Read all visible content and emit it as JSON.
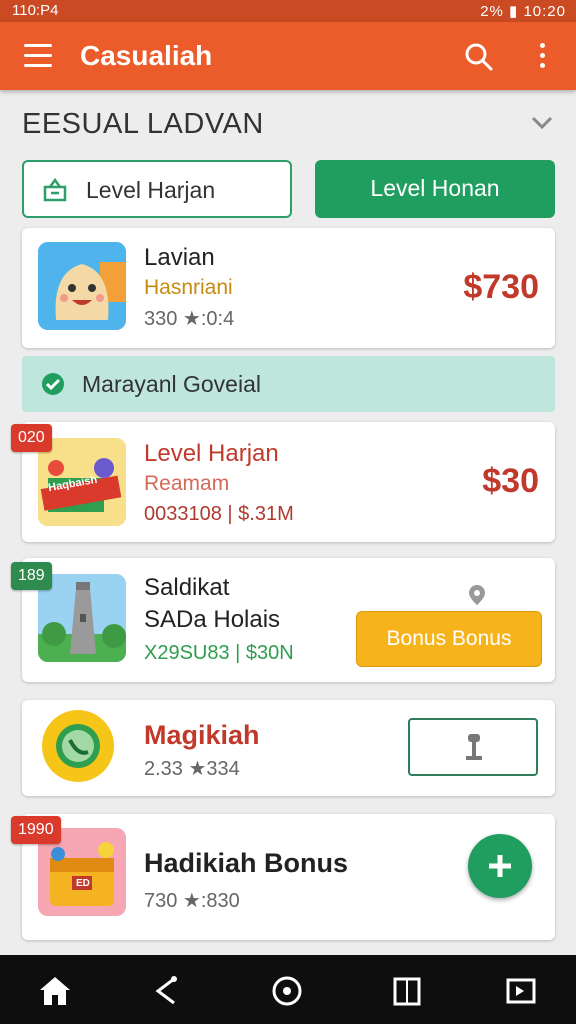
{
  "status": {
    "left": "110:P4",
    "right": "2% ▮ 10:20"
  },
  "appbar": {
    "title": "Casualiah"
  },
  "section": {
    "title": "EESUAL LADVAN"
  },
  "buttons": {
    "outline_label": "Level Harjan",
    "solid_label": "Level Honan"
  },
  "banner": {
    "label": "Marayanl Goveial"
  },
  "cards": [
    {
      "name": "Lavian",
      "sub": "Hasnriani",
      "meta": "330 ★:0:4",
      "price": "$730"
    },
    {
      "badge": "020",
      "name": "Level Harjan",
      "sub": "Reamam",
      "meta": "0033108 | $.31M",
      "price": "$30",
      "thumb_text": "Haqbaish"
    },
    {
      "badge": "189",
      "name": "Saldikat",
      "sub": "SADa Holais",
      "meta": "X29SU83 | $30N",
      "action": "Bonus Bonus"
    },
    {
      "name": "Magikiah",
      "meta": "2.33 ★334"
    },
    {
      "badge": "1990",
      "name": "Hadikiah Bonus",
      "meta": "730 ★:830",
      "thumb_text": "ED"
    }
  ],
  "colors": {
    "primary": "#ec5b2a",
    "green": "#1f9e5f",
    "price": "#c0392b",
    "bonus": "#f6b31c"
  }
}
